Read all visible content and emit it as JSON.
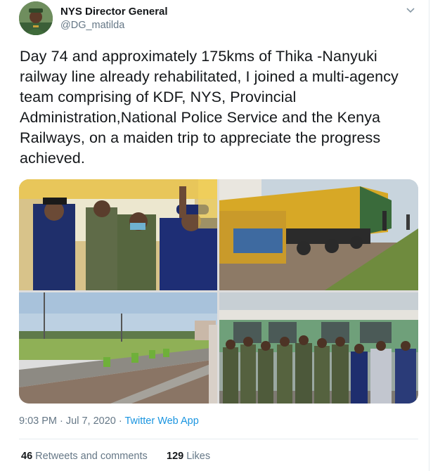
{
  "author": {
    "name": "NYS Director General",
    "handle": "@DG_matilda"
  },
  "tweet": {
    "text": "Day 74 and approximately 175kms of Thika -Nanyuki railway line already rehabilitated, I joined a multi-agency team comprising of KDF, NYS, Provincial Administration,National Police Service and the Kenya Railways, on a maiden trip to appreciate the progress achieved."
  },
  "meta": {
    "time": "9:03 PM",
    "separator": " · ",
    "date": "Jul 7, 2020",
    "source": "Twitter Web App"
  },
  "stats": {
    "retweets_count": "46",
    "retweets_label": "Retweets and comments",
    "likes_count": "129",
    "likes_label": "Likes"
  },
  "icons": {
    "caret": "chevron-down-icon"
  },
  "colors": {
    "link": "#1b95e0",
    "secondary_text": "#657786",
    "primary_text": "#14171a"
  }
}
